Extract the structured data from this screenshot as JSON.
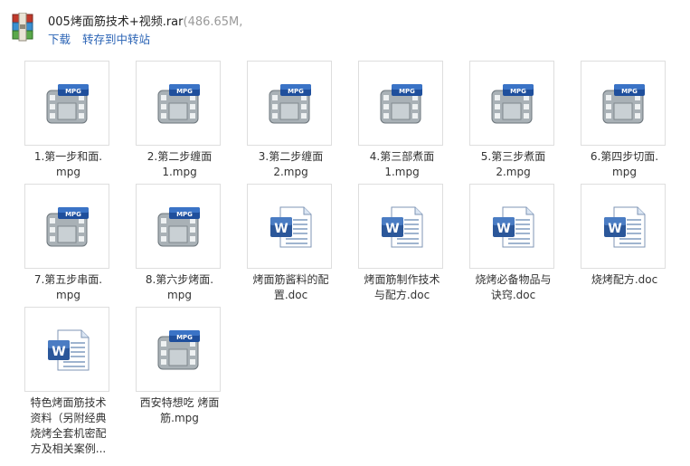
{
  "archive": {
    "name": "005烤面筋技术+视频.rar",
    "size": "(486.65M, (",
    "download_label": "下载",
    "save_label": "转存到中转站"
  },
  "icons": {
    "video": "mpg-file-icon",
    "doc": "word-doc-icon",
    "archive": "rar-archive-icon"
  },
  "colors": {
    "link": "#2a63b5",
    "thumb_border": "#dedede",
    "mpg_badge": "#1f4f9c",
    "word_blue": "#2b579a"
  },
  "files": [
    {
      "type": "mpg",
      "line1": "1.第一步和面.",
      "line2": "mpg",
      "line3": "",
      "line4": ""
    },
    {
      "type": "mpg",
      "line1": "2.第二步缠面",
      "line2": "1.mpg",
      "line3": "",
      "line4": ""
    },
    {
      "type": "mpg",
      "line1": "3.第二步缠面",
      "line2": "2.mpg",
      "line3": "",
      "line4": ""
    },
    {
      "type": "mpg",
      "line1": "4.第三部煮面",
      "line2": "1.mpg",
      "line3": "",
      "line4": ""
    },
    {
      "type": "mpg",
      "line1": "5.第三步煮面",
      "line2": "2.mpg",
      "line3": "",
      "line4": ""
    },
    {
      "type": "mpg",
      "line1": "6.第四步切面.",
      "line2": "mpg",
      "line3": "",
      "line4": ""
    },
    {
      "type": "mpg",
      "line1": "7.第五步串面.",
      "line2": "mpg",
      "line3": "",
      "line4": ""
    },
    {
      "type": "mpg",
      "line1": "8.第六步烤面.",
      "line2": "mpg",
      "line3": "",
      "line4": ""
    },
    {
      "type": "doc",
      "line1": "烤面筋酱料的配",
      "line2": "置.doc",
      "line3": "",
      "line4": ""
    },
    {
      "type": "doc",
      "line1": "烤面筋制作技术",
      "line2": "与配方.doc",
      "line3": "",
      "line4": ""
    },
    {
      "type": "doc",
      "line1": "烧烤必备物品与",
      "line2": "诀窍.doc",
      "line3": "",
      "line4": ""
    },
    {
      "type": "doc",
      "line1": "烧烤配方.doc",
      "line2": "",
      "line3": "",
      "line4": ""
    },
    {
      "type": "doc",
      "line1": "特色烤面筋技术",
      "line2": "资料（另附经典",
      "line3": "烧烤全套机密配",
      "line4": "方及相关案例..."
    },
    {
      "type": "mpg",
      "line1": "西安特想吃 烤面",
      "line2": "筋.mpg",
      "line3": "",
      "line4": ""
    }
  ]
}
